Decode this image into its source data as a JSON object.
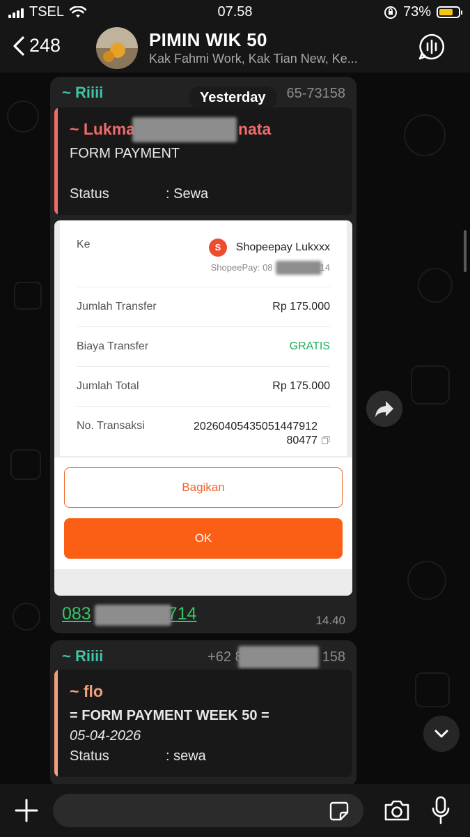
{
  "status_bar": {
    "carrier": "TSEL",
    "time": "07.58",
    "battery_percent_label": "73%",
    "battery_level": 0.73
  },
  "header": {
    "back_count": "248",
    "title": "PIMIN WIK 50",
    "subtitle": "Kak Fahmi Work, Kak Tian New, Ke..."
  },
  "date_pill": "Yesterday",
  "message1": {
    "sender": "~ Riiii",
    "phone_tail": "65-73158",
    "quote": {
      "author_prefix": "~ Lukma",
      "author_suffix": "nata",
      "line1": "FORM PAYMENT",
      "status_label": "Status",
      "status_value": ": Sewa"
    },
    "receipt": {
      "to_label": "Ke",
      "recipient": "Shopeepay Lukxxx",
      "account_prefix": "ShopeePay: 08",
      "account_suffix": "14",
      "rows": [
        {
          "label": "Jumlah Transfer",
          "value": "Rp 175.000"
        },
        {
          "label": "Biaya Transfer",
          "value": "GRATIS"
        },
        {
          "label": "Jumlah Total",
          "value": "Rp 175.000"
        }
      ],
      "txn_label": "No. Transaksi",
      "txn_line1": "20260405435051447912",
      "txn_line2": "80477",
      "share_label": "Bagikan",
      "ok_label": "OK"
    },
    "link_prefix": "083",
    "link_suffix": "714",
    "time": "14.40"
  },
  "message2": {
    "sender": "~ Riiii",
    "phone_prefix": "+62 8",
    "phone_suffix": "158",
    "quote": {
      "author": "~ flo",
      "line1": "= FORM PAYMENT WEEK 50 =",
      "line2": "05-04-2026",
      "status_label": "Status",
      "status_value": ": sewa"
    }
  },
  "colors": {
    "accent_green": "#35c466",
    "sender_teal": "#3cc5a8",
    "quote1_red": "#f26a6a",
    "quote2_orange": "#f0a07a",
    "shopee_orange": "#fb5f15",
    "free_green": "#1fae5b"
  }
}
